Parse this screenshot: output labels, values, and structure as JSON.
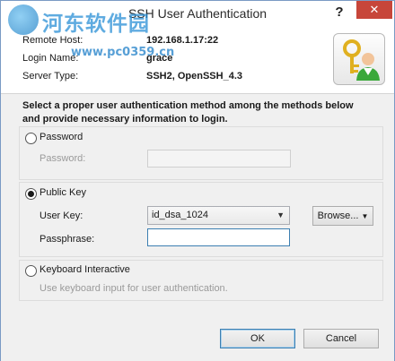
{
  "window": {
    "title": "SSH User Authentication",
    "help_label": "?",
    "close_label": "✕"
  },
  "watermark": {
    "line1": "河东软件园",
    "line2": "www.pc0359.cn"
  },
  "info": {
    "remote_host_label": "Remote Host:",
    "remote_host_value": "192.168.1.17:22",
    "login_name_label": "Login Name:",
    "login_name_value": "grace",
    "server_type_label": "Server Type:",
    "server_type_value": "SSH2, OpenSSH_4.3"
  },
  "instructions": "Select a proper user authentication method among the methods below and provide necessary information to login.",
  "password_method": {
    "radio_label": "Password",
    "selected": false,
    "field_label": "Password:",
    "field_value": ""
  },
  "publickey_method": {
    "radio_label": "Public Key",
    "selected": true,
    "user_key_label": "User Key:",
    "user_key_value": "id_dsa_1024",
    "browse_label": "Browse...",
    "passphrase_label": "Passphrase:",
    "passphrase_value": ""
  },
  "keyboard_method": {
    "radio_label": "Keyboard Interactive",
    "selected": false,
    "hint": "Use keyboard input for user authentication."
  },
  "buttons": {
    "ok": "OK",
    "cancel": "Cancel"
  },
  "icons": {
    "auth_icon": "key-user-icon",
    "dropdown_arrow": "chevron-down-icon",
    "browse_arrow": "triangle-down-icon"
  },
  "colors": {
    "close_button": "#c7463a",
    "focus_border": "#3c7fb1",
    "panel_bg": "#f0f0f0"
  }
}
